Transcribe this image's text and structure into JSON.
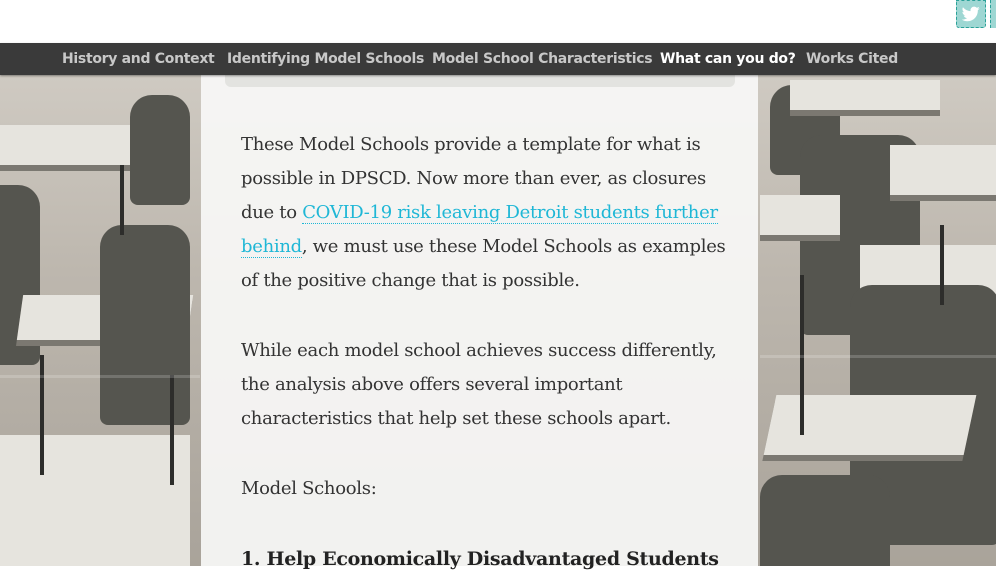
{
  "social": {
    "twitter_icon": "twitter-icon",
    "accent_color": "#2aa198"
  },
  "nav": {
    "items": [
      {
        "label": "History and Context",
        "active": false
      },
      {
        "label": "Identifying Model Schools",
        "active": false
      },
      {
        "label": "Model School Characteristics",
        "active": false
      },
      {
        "label": "What can you do?",
        "active": true
      },
      {
        "label": "Works Cited",
        "active": false
      }
    ]
  },
  "content": {
    "p1_before": "These Model Schools provide a template for what is possible in DPSCD. Now more than ever, as closures due to ",
    "p1_link": "COVID-19 risk leaving Detroit students further behind",
    "p1_after": ", we must use these Model Schools as examples of the positive change that is possible.",
    "p2": "While each model school achieves success differently, the analysis above offers several important characteristics that help set these schools apart.",
    "p3": "Model Schools:",
    "h1": "1. Help Economically Disadvantaged Students"
  },
  "colors": {
    "link": "#1fb7d6",
    "nav_bg": "#3a3a3a",
    "nav_active": "#ffffff"
  }
}
